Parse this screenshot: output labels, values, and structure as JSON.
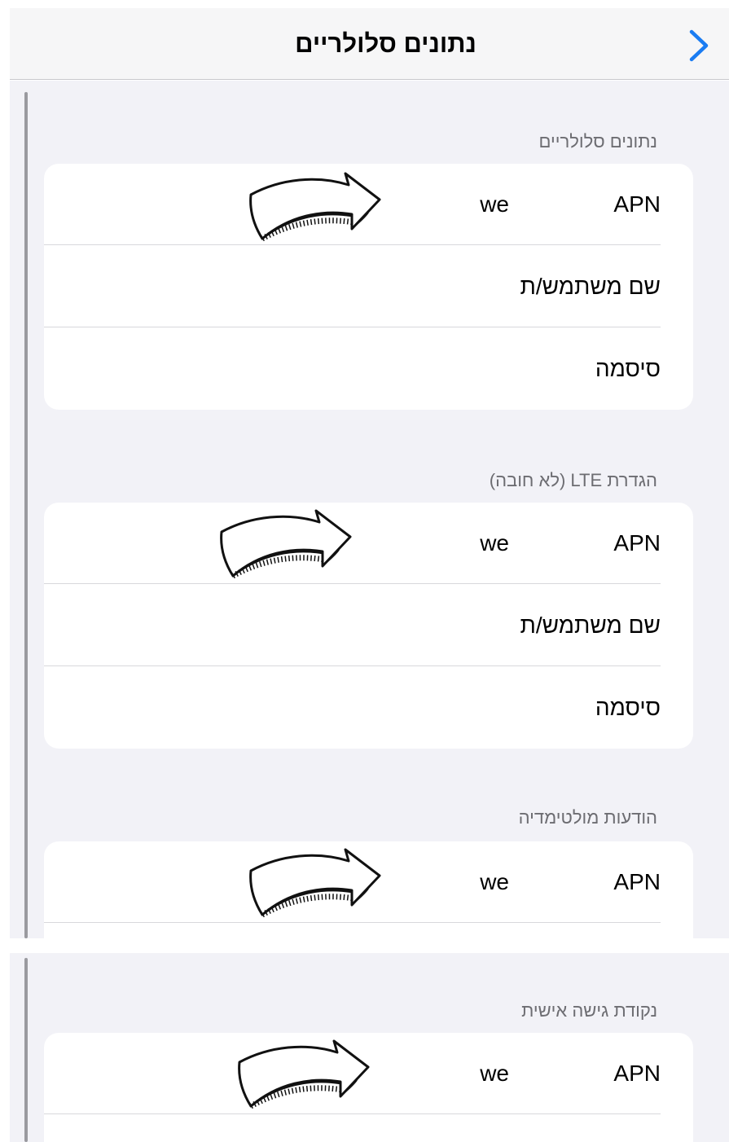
{
  "nav": {
    "title": "נתונים סלולריים",
    "back_icon": "chevron-right-icon",
    "accent": "#1a7cf2"
  },
  "sections": [
    {
      "header": "נתונים סלולריים",
      "rows": [
        {
          "label": "APN",
          "value": "we",
          "annotation": "arrow-icon"
        },
        {
          "label": "שם משתמש/ת",
          "value": ""
        },
        {
          "label": "סיסמה",
          "value": ""
        }
      ]
    },
    {
      "header": "הגדרת LTE (לא חובה)",
      "rows": [
        {
          "label": "APN",
          "value": "we",
          "annotation": "arrow-icon"
        },
        {
          "label": "שם משתמש/ת",
          "value": ""
        },
        {
          "label": "סיסמה",
          "value": ""
        }
      ]
    },
    {
      "header": "הודעות מולטימדיה",
      "rows": [
        {
          "label": "APN",
          "value": "we",
          "annotation": "arrow-icon"
        }
      ]
    },
    {
      "header": "נקודת גישה אישית",
      "rows": [
        {
          "label": "APN",
          "value": "we",
          "annotation": "arrow-icon"
        }
      ]
    }
  ]
}
